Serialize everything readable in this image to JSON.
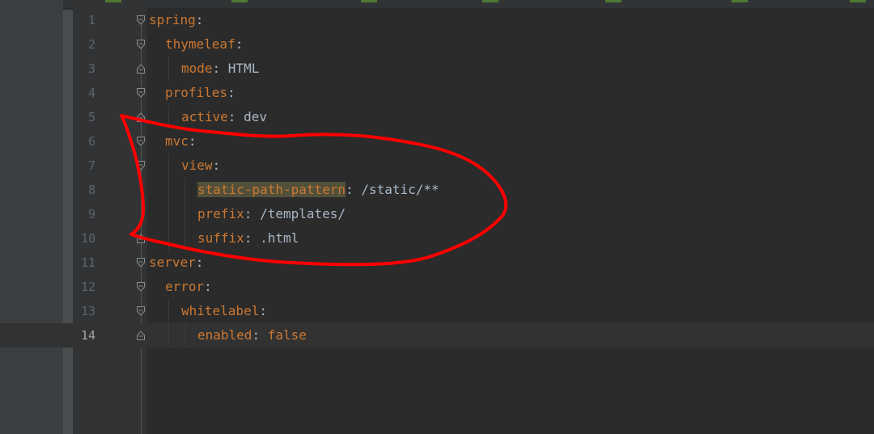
{
  "editor": {
    "lines": [
      {
        "num": "1",
        "key": "spring",
        "sep": ":",
        "value": ""
      },
      {
        "num": "2",
        "key": "thymeleaf",
        "sep": ":",
        "value": ""
      },
      {
        "num": "3",
        "key": "mode",
        "sep": ": ",
        "value": "HTML"
      },
      {
        "num": "4",
        "key": "profiles",
        "sep": ":",
        "value": ""
      },
      {
        "num": "5",
        "key": "active",
        "sep": ": ",
        "value": "dev"
      },
      {
        "num": "6",
        "key": "mvc",
        "sep": ":",
        "value": ""
      },
      {
        "num": "7",
        "key": "view",
        "sep": ":",
        "value": ""
      },
      {
        "num": "8",
        "key": "static-path-pattern",
        "sep": ": ",
        "value": "/static/**"
      },
      {
        "num": "9",
        "key": "prefix",
        "sep": ": ",
        "value": "/templates/"
      },
      {
        "num": "10",
        "key": "suffix",
        "sep": ": ",
        "value": ".html"
      },
      {
        "num": "11",
        "key": "server",
        "sep": ":",
        "value": ""
      },
      {
        "num": "12",
        "key": "error",
        "sep": ":",
        "value": ""
      },
      {
        "num": "13",
        "key": "whitelabel",
        "sep": ":",
        "value": ""
      },
      {
        "num": "14",
        "key": "enabled",
        "sep": ": ",
        "value": "false"
      }
    ]
  },
  "colors": {
    "background": "#2b2b2b",
    "key": "#cc7832",
    "text": "#a9b7c6",
    "annotation": "#ff0000",
    "highlight": "#52503a"
  }
}
